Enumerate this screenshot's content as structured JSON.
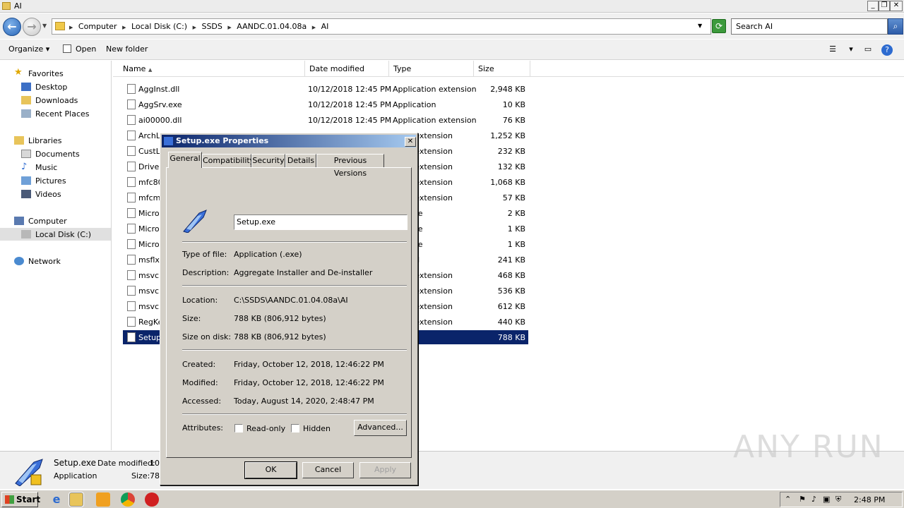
{
  "window": {
    "title": "AI"
  },
  "address": {
    "crumbs": [
      "Computer",
      "Local Disk (C:)",
      "SSDS",
      "AANDC.01.04.08a",
      "AI"
    ],
    "search_placeholder": "Search AI"
  },
  "toolbar": {
    "organize": "Organize",
    "open": "Open",
    "new_folder": "New folder"
  },
  "nav": {
    "favorites": "Favorites",
    "desktop": "Desktop",
    "downloads": "Downloads",
    "recent": "Recent Places",
    "libraries": "Libraries",
    "documents": "Documents",
    "music": "Music",
    "pictures": "Pictures",
    "videos": "Videos",
    "computer": "Computer",
    "local_disk": "Local Disk (C:)",
    "network": "Network"
  },
  "columns": {
    "name": "Name",
    "date": "Date modified",
    "type": "Type",
    "size": "Size"
  },
  "files": [
    {
      "name": "AggInst.dll",
      "date": "10/12/2018 12:45 PM",
      "type": "Application extension",
      "size": "2,948 KB"
    },
    {
      "name": "AggSrv.exe",
      "date": "10/12/2018 12:45 PM",
      "type": "Application",
      "size": "10 KB"
    },
    {
      "name": "ai00000.dll",
      "date": "10/12/2018 12:45 PM",
      "type": "Application extension",
      "size": "76 KB"
    },
    {
      "name": "ArchLi",
      "date": "",
      "type": "ation extension",
      "size": "1,252 KB"
    },
    {
      "name": "CustLi",
      "date": "",
      "type": "ation extension",
      "size": "232 KB"
    },
    {
      "name": "Driver",
      "date": "",
      "type": "ation extension",
      "size": "132 KB"
    },
    {
      "name": "mfc80",
      "date": "",
      "type": "ation extension",
      "size": "1,068 KB"
    },
    {
      "name": "mfcm8",
      "date": "",
      "type": "ation extension",
      "size": "57 KB"
    },
    {
      "name": "Micros",
      "date": "",
      "type": "EST File",
      "size": "2 KB"
    },
    {
      "name": "Micros",
      "date": "",
      "type": "EST File",
      "size": "1 KB"
    },
    {
      "name": "Micros",
      "date": "",
      "type": "EST File",
      "size": "1 KB"
    },
    {
      "name": "msflxg",
      "date": "",
      "type": "control",
      "size": "241 KB"
    },
    {
      "name": "msvcm",
      "date": "",
      "type": "ation extension",
      "size": "468 KB"
    },
    {
      "name": "msvcp",
      "date": "",
      "type": "ation extension",
      "size": "536 KB"
    },
    {
      "name": "msvcr",
      "date": "",
      "type": "ation extension",
      "size": "612 KB"
    },
    {
      "name": "RegKe",
      "date": "",
      "type": "ation extension",
      "size": "440 KB"
    },
    {
      "name": "Setup",
      "date": "",
      "type": "ation",
      "size": "788 KB"
    }
  ],
  "details": {
    "name": "Setup.exe",
    "date_label": "Date modified:",
    "date_value": "10",
    "type": "Application",
    "size_label": "Size:",
    "size_value": "78"
  },
  "dialog": {
    "title": "Setup.exe Properties",
    "close": "✕",
    "tabs": [
      "General",
      "Compatibility",
      "Security",
      "Details",
      "Previous Versions"
    ],
    "filename": "Setup.exe",
    "type_label": "Type of file:",
    "type_value": "Application (.exe)",
    "desc_label": "Description:",
    "desc_value": "Aggregate Installer and De-installer",
    "location_label": "Location:",
    "location_value": "C:\\SSDS\\AANDC.01.04.08a\\AI",
    "size_label": "Size:",
    "size_value": "788 KB (806,912 bytes)",
    "sizedisk_label": "Size on disk:",
    "sizedisk_value": "788 KB (806,912 bytes)",
    "created_label": "Created:",
    "created_value": "Friday, October 12, 2018, 12:46:22 PM",
    "modified_label": "Modified:",
    "modified_value": "Friday, October 12, 2018, 12:46:22 PM",
    "accessed_label": "Accessed:",
    "accessed_value": "Today, August 14, 2020, 2:48:47 PM",
    "attributes_label": "Attributes:",
    "readonly": "Read-only",
    "hidden": "Hidden",
    "advanced": "Advanced...",
    "ok": "OK",
    "cancel": "Cancel",
    "apply": "Apply"
  },
  "taskbar": {
    "start": "Start",
    "clock": "2:48 PM"
  },
  "watermark": "ANY RUN"
}
